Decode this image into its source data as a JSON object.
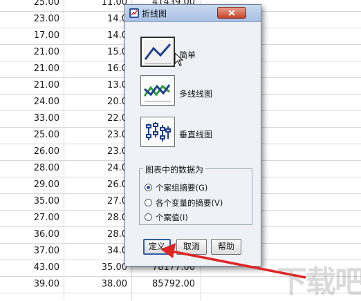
{
  "spreadsheet": {
    "rows": [
      [
        "25.00",
        "11.00",
        "41439.00"
      ],
      [
        "23.00",
        "14.0",
        ""
      ],
      [
        "17.00",
        "14.0",
        ""
      ],
      [
        "21.00",
        "15.0",
        ""
      ],
      [
        "21.00",
        "16.0",
        ""
      ],
      [
        "21.00",
        "13.0",
        ""
      ],
      [
        "24.00",
        "20.0",
        ""
      ],
      [
        "33.00",
        "22.0",
        ""
      ],
      [
        "25.00",
        "23.0",
        ""
      ],
      [
        "26.00",
        "23.0",
        ""
      ],
      [
        "28.00",
        "24.0",
        ""
      ],
      [
        "29.00",
        "26.0",
        ""
      ],
      [
        "35.00",
        "27.0",
        ""
      ],
      [
        "27.00",
        "28.0",
        ""
      ],
      [
        "36.00",
        "28.0",
        ""
      ],
      [
        "37.00",
        "34.0",
        ""
      ],
      [
        "43.00",
        "35.00",
        "78177.00"
      ],
      [
        "39.00",
        "38.00",
        "85792.00"
      ]
    ]
  },
  "dialog": {
    "title": "折线图",
    "chart_types": [
      {
        "label": "简单",
        "icon": "simple-line-chart-icon",
        "selected": true
      },
      {
        "label": "多线线图",
        "icon": "multiple-line-chart-icon",
        "selected": false
      },
      {
        "label": "垂直线图",
        "icon": "drop-line-chart-icon",
        "selected": false
      }
    ],
    "group": {
      "title": "图表中的数据为",
      "options": [
        {
          "label": "个案组摘要(G)",
          "checked": true
        },
        {
          "label": "各个变量的摘要(V)",
          "checked": false
        },
        {
          "label": "个案值(I)",
          "checked": false
        }
      ]
    },
    "buttons": {
      "define": "定义",
      "cancel": "取消",
      "help": "帮助"
    }
  },
  "colors": {
    "line_blue": "#1f3e8f",
    "line_green": "#2e9a3a",
    "arrow_red": "#e02424"
  },
  "watermark": "下载吧"
}
